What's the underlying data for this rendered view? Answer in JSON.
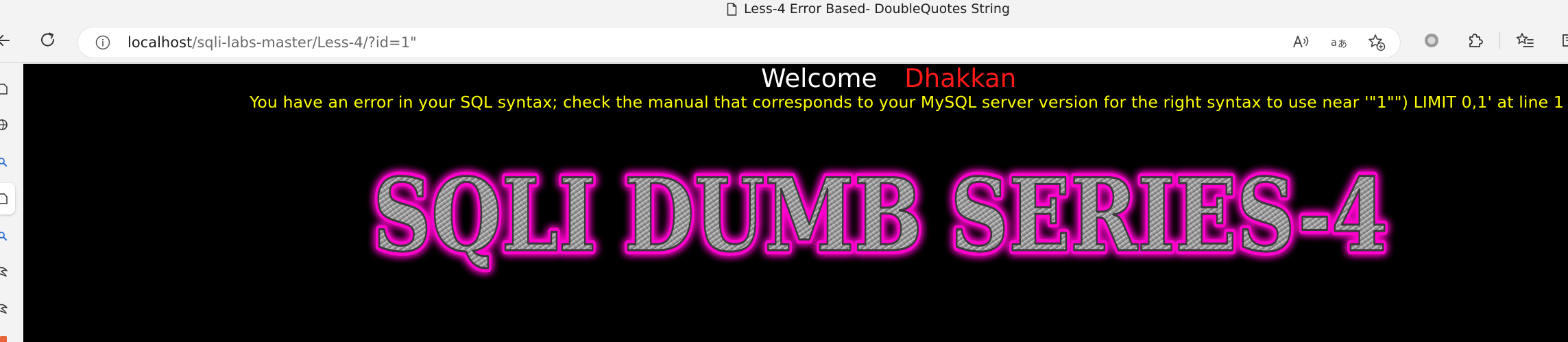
{
  "window": {
    "title": "Less-4 Error Based- DoubleQuotes String"
  },
  "toolbar": {
    "url_host": "localhost",
    "url_path": "/sqli-labs-master/Less-4/?id=1\""
  },
  "page": {
    "welcome_label": "Welcome",
    "welcome_name": "Dhakkan",
    "error_message": "You have an error in your SQL syntax; check the manual that corresponds to your MySQL server version for the right syntax to use near '\"1\"\") LIMIT 0,1' at line 1",
    "banner_text": "SQLI DUMB SERIES-4"
  },
  "colors": {
    "page_background": "#000000",
    "welcome_text": "#ffffff",
    "name_text": "#ff1a1a",
    "error_text": "#ffff00",
    "banner_glow": "#ff00cc"
  }
}
